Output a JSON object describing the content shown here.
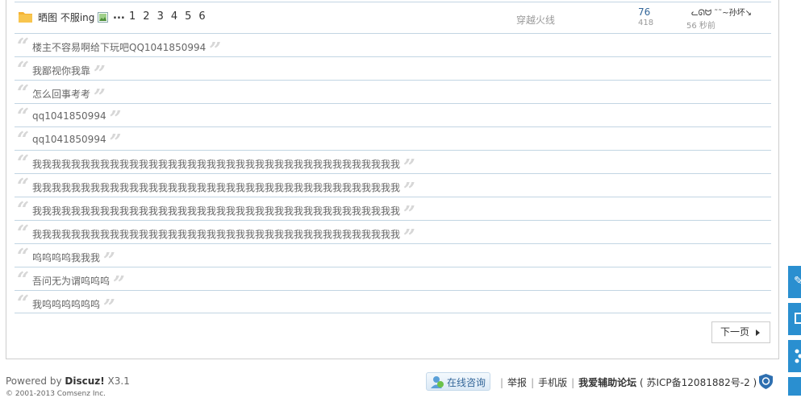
{
  "thread": {
    "title": "晒图 不服ing",
    "ellipsis": "...",
    "pages": [
      "1",
      "2",
      "3",
      "4",
      "5",
      "6"
    ],
    "author": "穿越火线",
    "replies": "76",
    "views": "418",
    "last_user": "ᓚᘏᗢ ˜˜~孙坏↘",
    "last_time": "56 秒前"
  },
  "reply_rows": [
    "楼主不容易啊给下玩吧QQ1041850994",
    "我鄙视你我靠",
    "怎么回事考考",
    "qq1041850994",
    "qq1041850994",
    "我我我我我我我我我我我我我我我我我我我我我我我我我我我我我我我我我我我我我我",
    "我我我我我我我我我我我我我我我我我我我我我我我我我我我我我我我我我我我我我我",
    "我我我我我我我我我我我我我我我我我我我我我我我我我我我我我我我我我我我我我我",
    "我我我我我我我我我我我我我我我我我我我我我我我我我我我我我我我我我我我我我我",
    "呜呜呜呜我我我",
    "吾问无为谓呜呜呜",
    "我呜呜呜呜呜呜"
  ],
  "quote_open": "“",
  "quote_close": "”",
  "pager": {
    "next_label": "下一页"
  },
  "footer": {
    "powered_prefix": "Powered by ",
    "brand": "Discuz!",
    "version": " X3.1",
    "copyright": "© 2001-2013 Comsenz Inc.",
    "consult_label": "在线咨询",
    "links": [
      "举报",
      "手机版"
    ],
    "site_name": "我爱辅助论坛",
    "icp": "( 苏ICP备12081882号-2 )"
  },
  "colors": {
    "link_blue": "#369",
    "row_border": "#c2d5e3",
    "side_blue": "#2a8fd0",
    "quote_gray": "#d7d7d7"
  }
}
